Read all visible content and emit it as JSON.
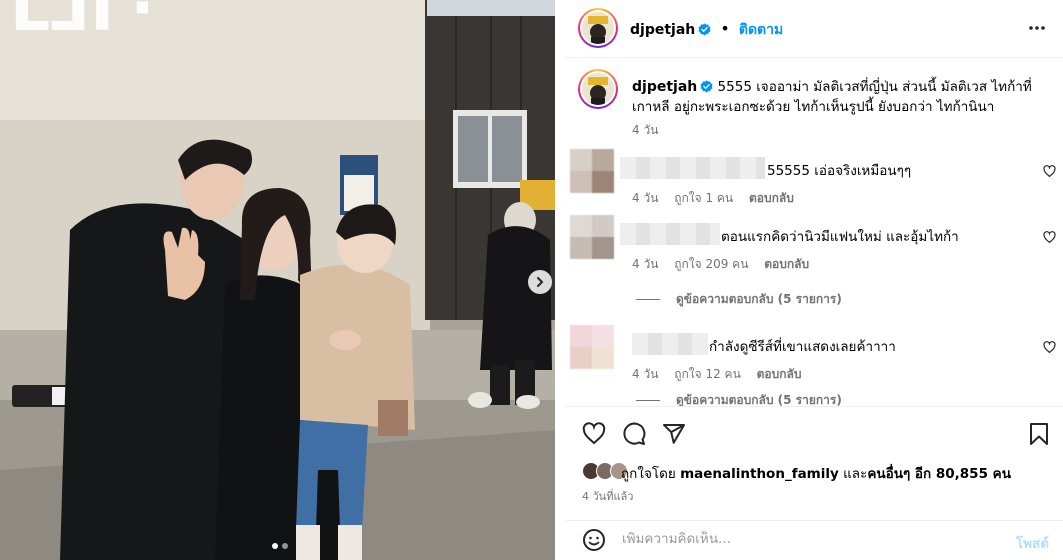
{
  "post": {
    "author": "djpetjah",
    "follow_label": "ติดตาม",
    "caption": "5555 เจออาม่า มัลติเวสที่ญี่ปุ่น ส่วนนี้ มัลติเวส ไทก้าที่เกาหลี อยู่กะพระเอกซะด้วย ไทก้าเห็นรูปนี้ ยังบอกว่า ไทก้านินา",
    "caption_time": "4 วัน",
    "colors": {
      "accent": "#0095f6",
      "verified": "#0095f6",
      "muted": "#737373"
    }
  },
  "comments": [
    {
      "text": "55555 เอ่อจริงเหมือนๆๆ",
      "time": "4 วัน",
      "likes": "ถูกใจ 1 คน",
      "reply": "ตอบกลับ"
    },
    {
      "text": "ตอนแรกคิดว่านิวมีแฟนใหม่ และอุ้มไทก้า",
      "time": "4 วัน",
      "likes": "ถูกใจ 209 คน",
      "reply": "ตอบกลับ",
      "view_replies": "ดูข้อความตอบกลับ (5 รายการ)"
    },
    {
      "text": "กำลังดูซีรีส์ที่เขาแสดงเลยค้าาาา",
      "time": "4 วัน",
      "likes": "ถูกใจ 12 คน",
      "reply": "ตอบกลับ",
      "view_replies": "ดูข้อความตอบกลับ (5 รายการ)"
    }
  ],
  "likes": {
    "prefix": "ถูกใจโดย",
    "user": "maenalinthon_family",
    "middle": "และ",
    "others": "คนอื่นๆ อีก 80,855 คน"
  },
  "posted_ago": "4 วันที่แล้ว",
  "add_comment": {
    "placeholder": "เพิ่มความคิดเห็น...",
    "post_label": "โพสต์"
  },
  "icons": [
    "heart-icon",
    "comment-icon",
    "share-icon",
    "bookmark-icon",
    "emoji-icon",
    "more-icon",
    "verified-icon",
    "chevron-right-icon"
  ]
}
